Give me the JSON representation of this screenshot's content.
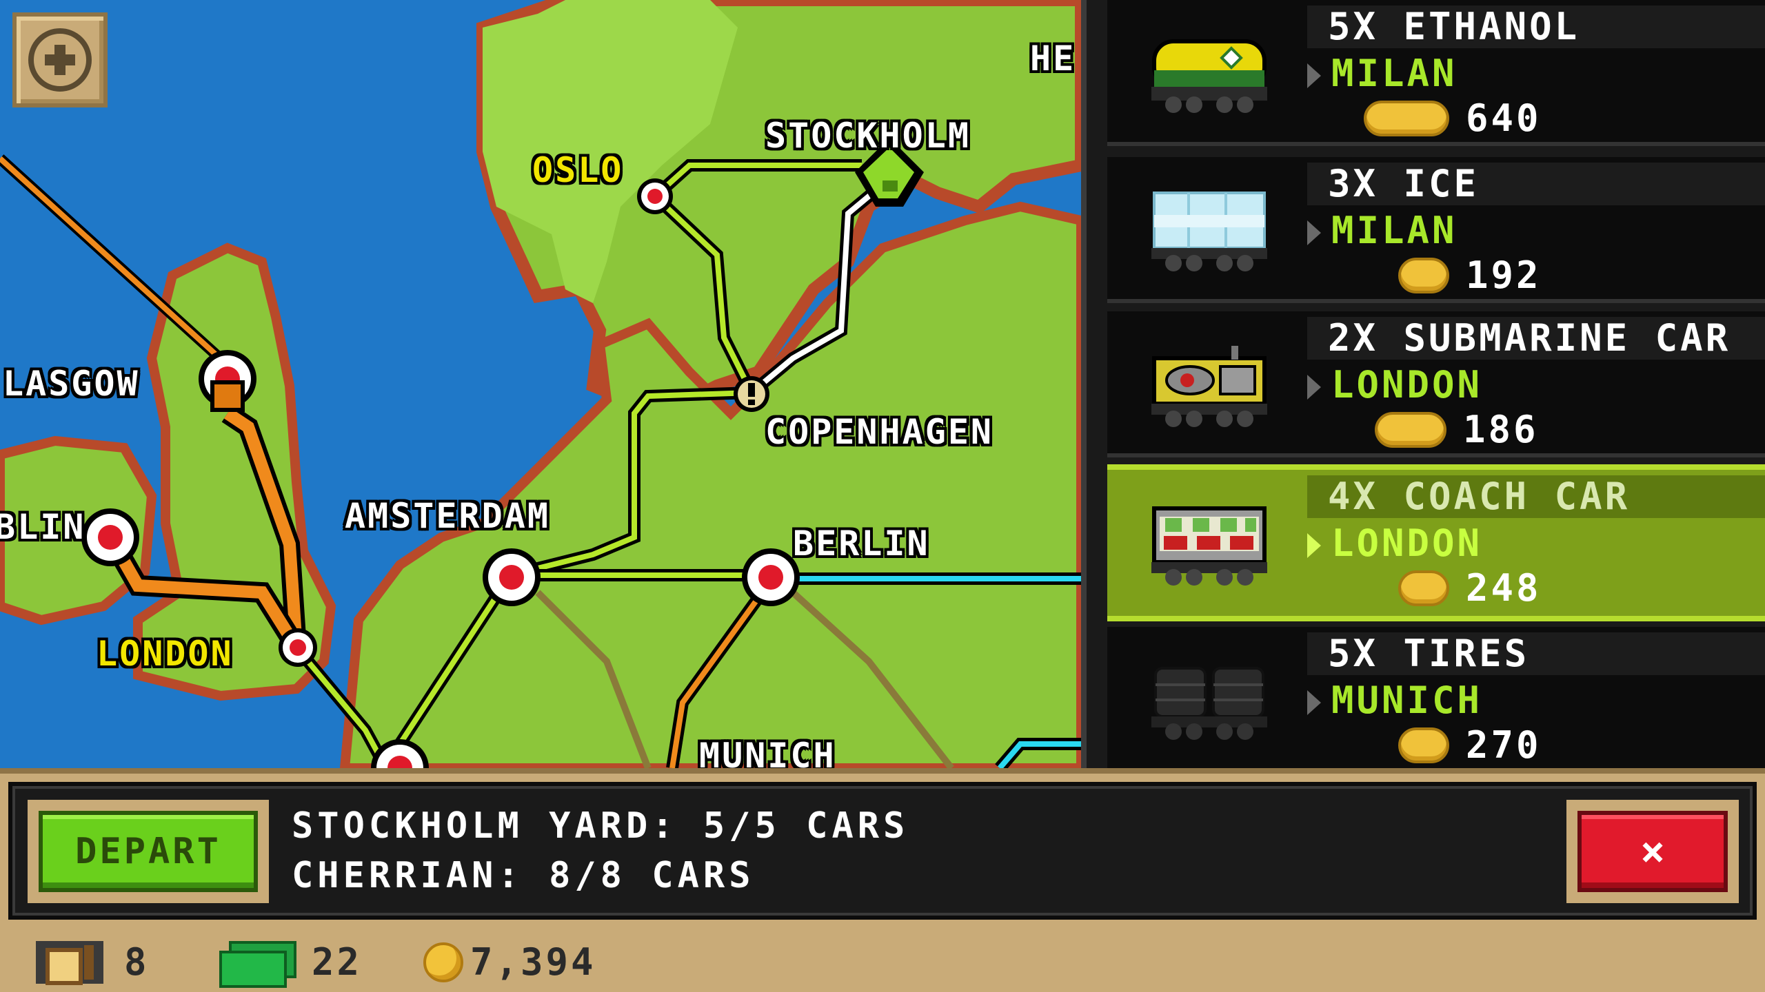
{
  "map": {
    "zoom_button_label": "+",
    "cities": [
      {
        "name": "OSLO",
        "color": "#f2e600"
      },
      {
        "name": "STOCKHOLM",
        "color": "#ffffff"
      },
      {
        "name": "LASGOW",
        "color": "#ffffff"
      },
      {
        "name": "COPENHAGEN",
        "color": "#ffffff"
      },
      {
        "name": "AMSTERDAM",
        "color": "#ffffff"
      },
      {
        "name": "BLIN",
        "color": "#ffffff"
      },
      {
        "name": "BERLIN",
        "color": "#ffffff"
      },
      {
        "name": "LONDON",
        "color": "#f2e600"
      },
      {
        "name": "MUNICH",
        "color": "#ffffff"
      },
      {
        "name": "HE",
        "color": "#ffffff"
      }
    ]
  },
  "cargo_list": [
    {
      "title": "5X ETHANOL",
      "destination": "MILAN",
      "price": "640",
      "selected": false,
      "thumb": "tanker-car-icon"
    },
    {
      "title": "3X ICE",
      "destination": "MILAN",
      "price": "192",
      "selected": false,
      "thumb": "ice-car-icon"
    },
    {
      "title": "2X SUBMARINE CAR",
      "destination": "LONDON",
      "price": "186",
      "selected": false,
      "thumb": "submarine-car-icon"
    },
    {
      "title": "4X COACH CAR",
      "destination": "LONDON",
      "price": "248",
      "selected": true,
      "thumb": "coach-car-icon"
    },
    {
      "title": "5X TIRES",
      "destination": "MUNICH",
      "price": "270",
      "selected": false,
      "thumb": "tires-car-icon"
    }
  ],
  "dialog": {
    "depart_label": "DEPART",
    "line1": "STOCKHOLM YARD: 5/5 CARS",
    "line2": "CHERRIAN: 8/8 CARS",
    "close_label": "×"
  },
  "stats": {
    "cars": "8",
    "cash": "22",
    "coins": "7,394"
  },
  "colors": {
    "water": "#1f78c8",
    "land": "#8cc63a",
    "selected_row": "#7ea01a",
    "destination_text": "#a8e82a"
  }
}
